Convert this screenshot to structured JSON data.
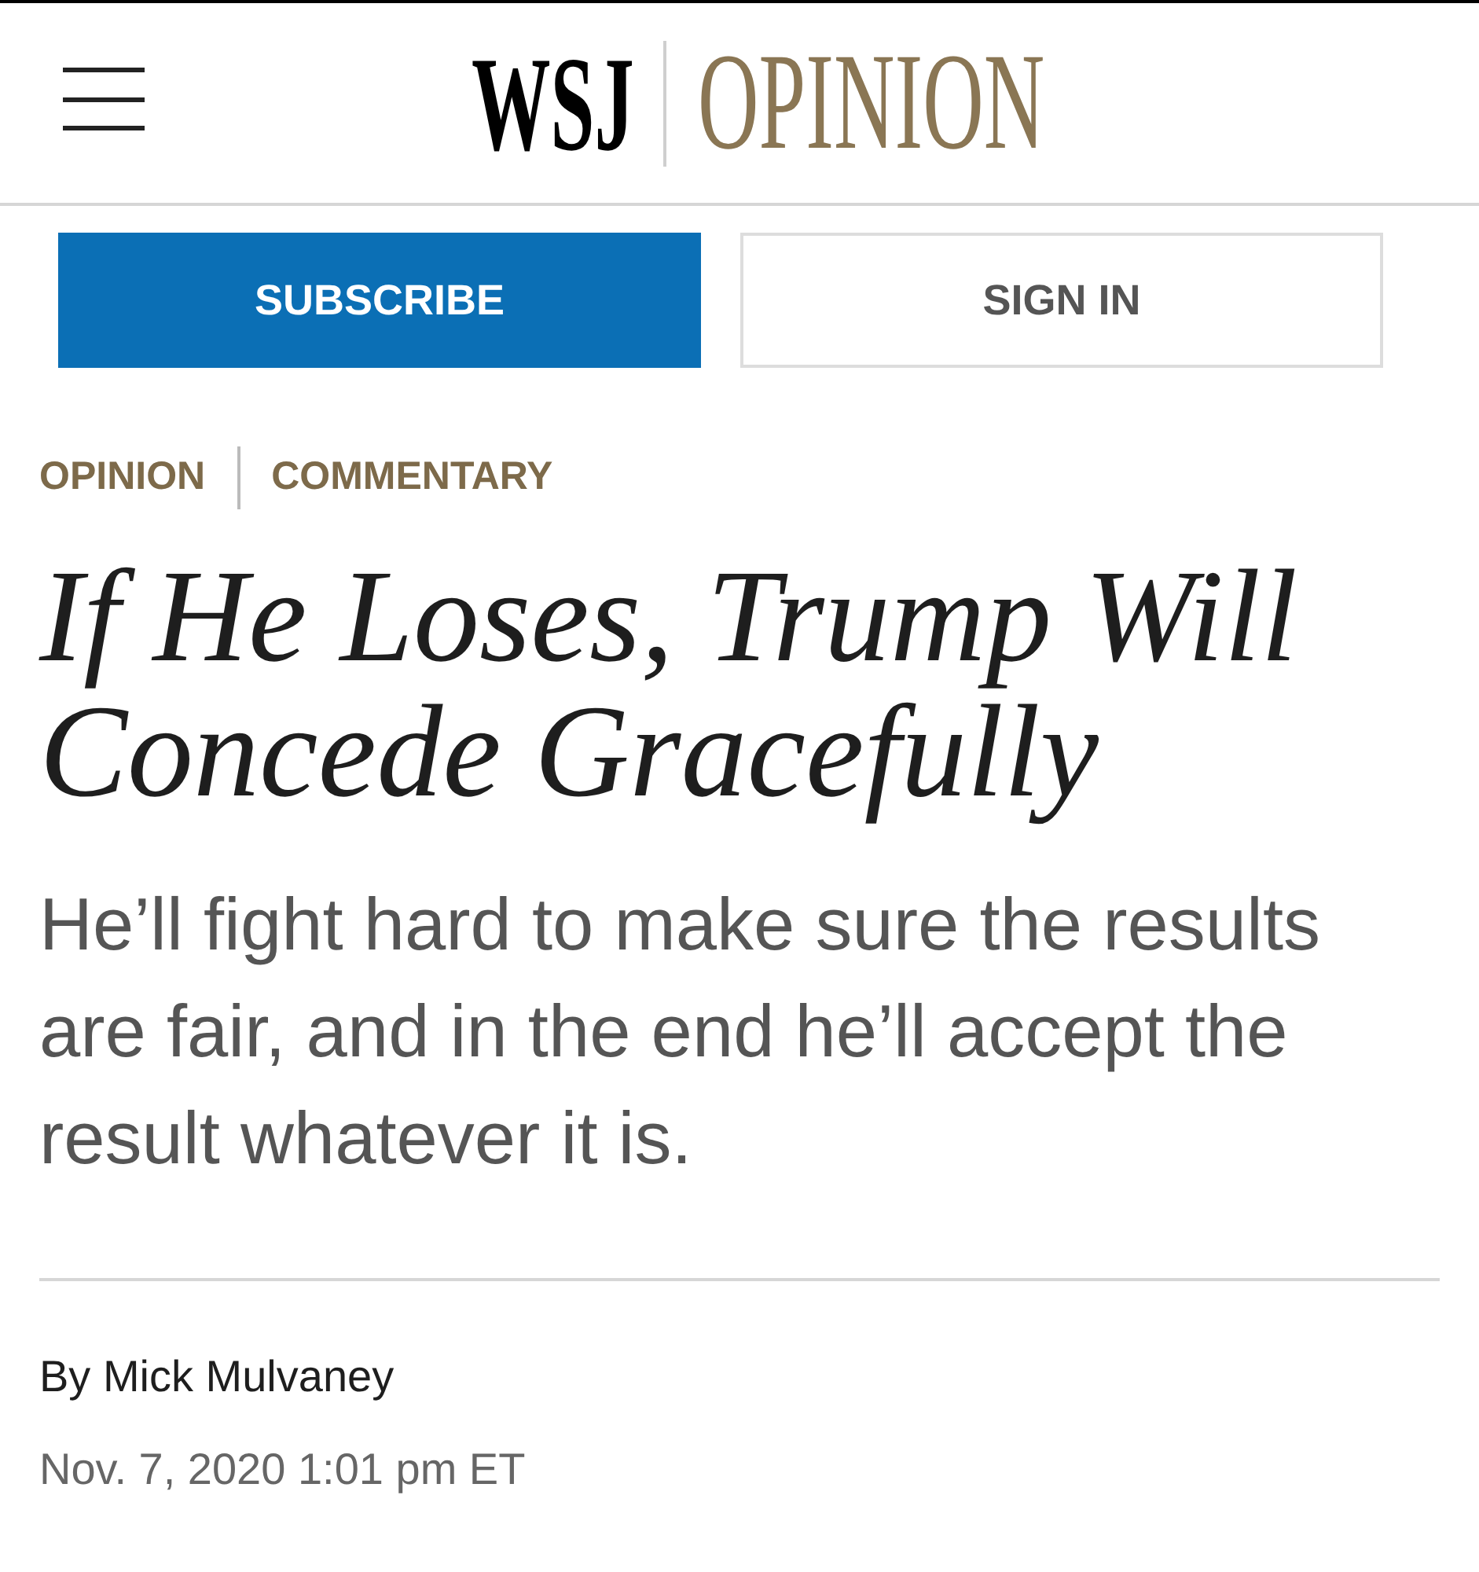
{
  "header": {
    "logo_wordmark": "WSJ",
    "section_title": "OPINION"
  },
  "buttons": [
    {
      "label": "SUBSCRIBE",
      "kind": "primary"
    },
    {
      "label": "SIGN IN",
      "kind": "secondary"
    }
  ],
  "breadcrumb": [
    "OPINION",
    "COMMENTARY"
  ],
  "headline": "If He Loses, Trump Will Concede Gracefully",
  "dek": "He’ll fight hard to make sure the results are fair, and in the end he’ll accept the result whatever it is.",
  "byline": "By Mick Mulvaney",
  "timestamp": "Nov. 7, 2020 1:01 pm ET"
}
